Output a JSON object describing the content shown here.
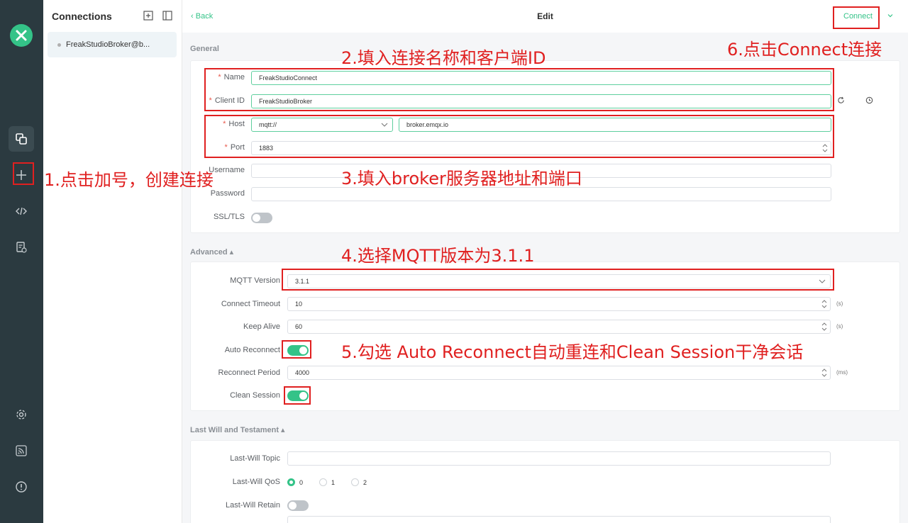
{
  "sidebar_rail": {
    "items": [
      {
        "icon": "connections-icon",
        "active": true
      },
      {
        "icon": "plus-icon",
        "active": false
      },
      {
        "icon": "code-icon",
        "active": false
      },
      {
        "icon": "log-icon",
        "active": false
      },
      {
        "icon": "gear-icon",
        "active": false
      },
      {
        "icon": "feed-icon",
        "active": false
      },
      {
        "icon": "info-icon",
        "active": false
      }
    ]
  },
  "connections": {
    "title": "Connections",
    "items": [
      {
        "label": "FreakStudioBroker@b..."
      }
    ]
  },
  "header": {
    "back_label": "Back",
    "title": "Edit",
    "connect_label": "Connect"
  },
  "general": {
    "section_title": "General",
    "name_label": "Name",
    "name_value": "FreakStudioConnect",
    "client_id_label": "Client ID",
    "client_id_value": "FreakStudioBroker",
    "host_label": "Host",
    "protocol_value": "mqtt://",
    "host_value": "broker.emqx.io",
    "port_label": "Port",
    "port_value": "1883",
    "username_label": "Username",
    "username_value": "",
    "password_label": "Password",
    "password_value": "",
    "ssl_label": "SSL/TLS",
    "ssl_enabled": false
  },
  "advanced": {
    "section_title": "Advanced",
    "mqtt_version_label": "MQTT Version",
    "mqtt_version_value": "3.1.1",
    "connect_timeout_label": "Connect Timeout",
    "connect_timeout_value": "10",
    "connect_timeout_unit": "(s)",
    "keep_alive_label": "Keep Alive",
    "keep_alive_value": "60",
    "keep_alive_unit": "(s)",
    "auto_reconnect_label": "Auto Reconnect",
    "auto_reconnect_enabled": true,
    "reconnect_period_label": "Reconnect Period",
    "reconnect_period_value": "4000",
    "reconnect_period_unit": "(ms)",
    "clean_session_label": "Clean Session",
    "clean_session_enabled": true
  },
  "last_will": {
    "section_title": "Last Will and Testament",
    "topic_label": "Last-Will Topic",
    "topic_value": "",
    "qos_label": "Last-Will QoS",
    "qos_options": [
      "0",
      "1",
      "2"
    ],
    "qos_selected": "0",
    "retain_label": "Last-Will Retain",
    "retain_enabled": false
  },
  "annotations": {
    "step1": "1.点击加号，创建连接",
    "step2": "2.填入连接名称和客户端ID",
    "step3": "3.填入broker服务器地址和端口",
    "step4": "4.选择MQTT版本为3.1.1",
    "step5": "5.勾选 Auto Reconnect自动重连和Clean Session干净会话",
    "step6": "6.点击Connect连接"
  },
  "colors": {
    "accent": "#34c388",
    "rail_bg": "#2b3a40",
    "annotation_red": "#e02020",
    "required_red": "#e8584b"
  }
}
